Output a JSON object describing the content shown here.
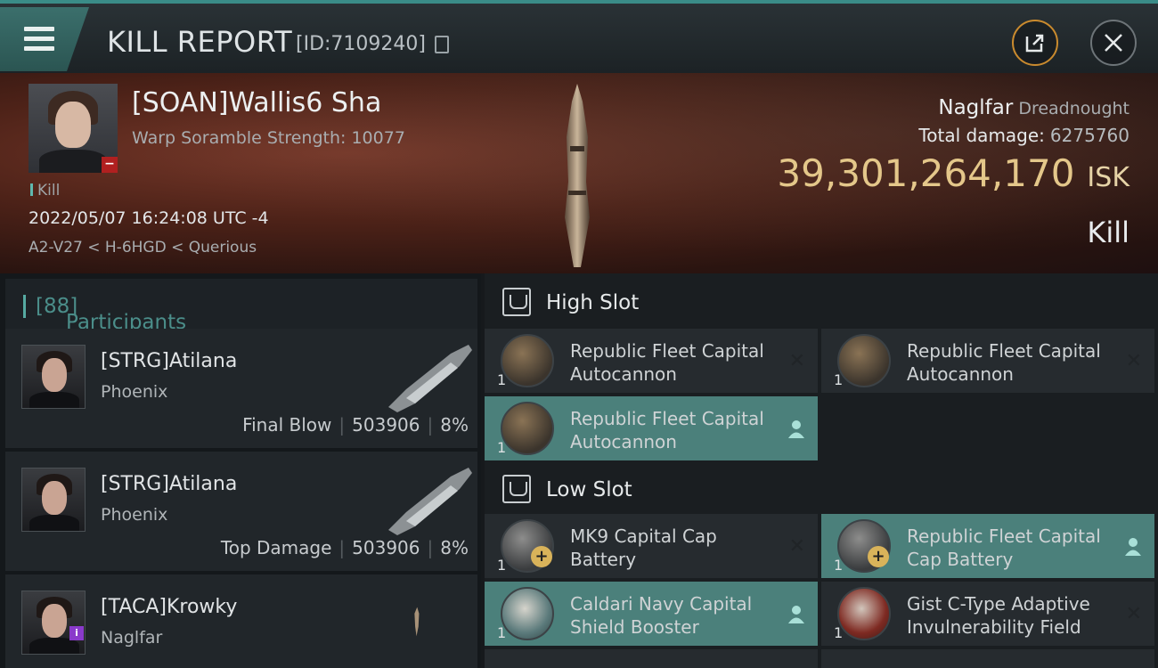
{
  "header": {
    "title": "KILL REPORT",
    "report_id": "[ID:7109240]"
  },
  "victim": {
    "name": "[SOAN]Wallis6 Sha",
    "warp_scramble": "Warp Soramble Strength: 10077",
    "kill_tag": "Kill",
    "datetime": "2022/05/07 16:24:08 UTC -4",
    "location": "A2-V27 < H-6HGD < Querious",
    "ship": "Naglfar",
    "ship_class": "Dreadnought",
    "total_damage_label": "Total damage:",
    "total_damage": "6275760",
    "isk_value": "39,301,264,170",
    "isk_unit": "ISK",
    "result": "Kill"
  },
  "participants": {
    "label": "Participants",
    "count": "[88]",
    "rows": [
      {
        "name": "[STRG]Atilana",
        "ship": "Phoenix",
        "role": "Final Blow",
        "damage": "503906",
        "percent": "8%"
      },
      {
        "name": "[STRG]Atilana",
        "ship": "Phoenix",
        "role": "Top Damage",
        "damage": "503906",
        "percent": "8%"
      },
      {
        "name": "[TACA]Krowky",
        "ship": "Naglfar"
      }
    ]
  },
  "fitting": {
    "high_slot_label": "High Slot",
    "low_slot_label": "Low Slot",
    "high": [
      {
        "line1": "Republic Fleet Capital",
        "line2": "Autocannon",
        "qty": "1",
        "state": "destroyed"
      },
      {
        "line1": "Republic Fleet Capital",
        "line2": "Autocannon",
        "qty": "1",
        "state": "destroyed"
      },
      {
        "line1": "Republic Fleet Capital",
        "line2": "Autocannon",
        "qty": "1",
        "state": "dropped"
      }
    ],
    "low": [
      {
        "line1": "MK9 Capital Cap",
        "line2": "Battery",
        "qty": "1",
        "state": "destroyed"
      },
      {
        "line1": "Republic Fleet Capital",
        "line2": "Cap Battery",
        "qty": "1",
        "state": "dropped"
      },
      {
        "line1": "Caldari Navy Capital",
        "line2": "Shield Booster",
        "qty": "1",
        "state": "dropped"
      },
      {
        "line1": "Gist C-Type Adaptive",
        "line2": "Invulnerability Field",
        "qty": "1",
        "state": "destroyed"
      }
    ]
  },
  "icons": {
    "menu": "hamburger-icon",
    "copy": "copy-icon",
    "share": "share-icon",
    "close": "close-icon",
    "destroyed": "x-icon",
    "dropped": "person-icon"
  },
  "colors": {
    "accent": "#3a8c88",
    "isk": "#e4c78a",
    "dropped_bg": "#4b807b"
  }
}
